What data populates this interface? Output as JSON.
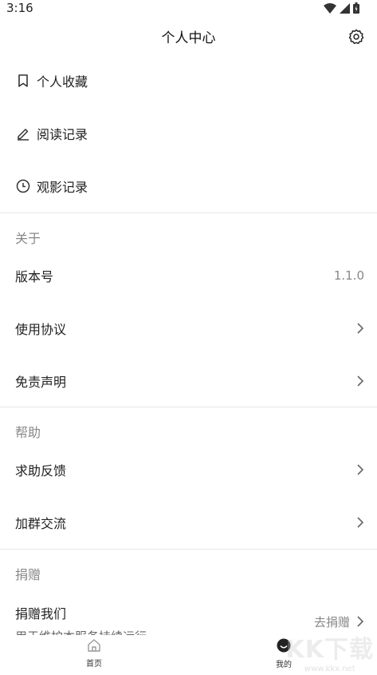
{
  "status_bar": {
    "time": "3:16"
  },
  "header": {
    "title": "个人中心"
  },
  "menu": {
    "favorites": "个人收藏",
    "reading_history": "阅读记录",
    "watch_history": "观影记录"
  },
  "about": {
    "title": "关于",
    "version_label": "版本号",
    "version_value": "1.1.0",
    "terms": "使用协议",
    "disclaimer": "免责声明"
  },
  "help": {
    "title": "帮助",
    "feedback": "求助反馈",
    "join_group": "加群交流"
  },
  "donate": {
    "title": "捐赠",
    "donate_us": "捐赠我们",
    "description": "用于维护本服务持续运行",
    "go_donate": "去捐赠"
  },
  "tabbar": {
    "home": "首页",
    "mine": "我的"
  },
  "watermark": {
    "text": "KK下载",
    "url": "www.kkx.net"
  }
}
